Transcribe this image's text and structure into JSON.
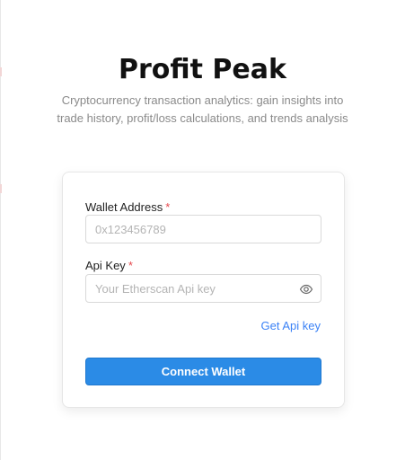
{
  "header": {
    "title": "Profit Peak",
    "subtitle": "Cryptocurrency transaction analytics: gain insights into trade history, profit/loss calculations, and trends analysis"
  },
  "form": {
    "wallet": {
      "label": "Wallet Address",
      "required_marker": "*",
      "placeholder": "0x123456789",
      "value": ""
    },
    "api_key": {
      "label": "Api Key",
      "required_marker": "*",
      "placeholder": "Your Etherscan Api key",
      "value": "",
      "toggle_icon": "eye-icon"
    },
    "get_api_key_link": "Get Api key",
    "submit_label": "Connect Wallet"
  },
  "colors": {
    "primary": "#2b8be6",
    "link": "#3b82f6",
    "required": "#e5484d"
  }
}
